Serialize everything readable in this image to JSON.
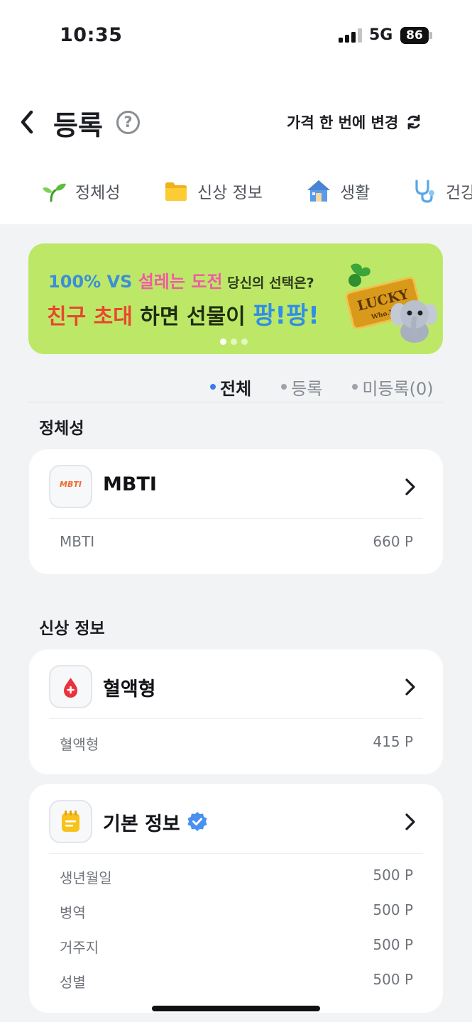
{
  "status_bar": {
    "time": "10:35",
    "network": "5G",
    "battery": "86"
  },
  "header": {
    "title": "등록",
    "help_icon": "question-circle-icon",
    "price_change_label": "가격 한 번에 변경"
  },
  "category_tabs": [
    {
      "label": "정체성",
      "icon": "sprout-icon"
    },
    {
      "label": "신상 정보",
      "icon": "folder-icon"
    },
    {
      "label": "생활",
      "icon": "house-icon"
    },
    {
      "label": "건강",
      "icon": "stethoscope-icon"
    }
  ],
  "banner": {
    "line1_part1": "100% VS ",
    "line1_part2": "설레는 도전",
    "line1_part3": " 당신의 선택은?",
    "line2_part1": "친구 초대",
    "line2_part2": " 하면 선물이 ",
    "line2_part3": "팡!팡!",
    "ticket_text": "LUCKY",
    "ticket_sub": "Who.M.I",
    "pages": 3,
    "current_page": 1
  },
  "filter": {
    "all": "전체",
    "registered": "등록",
    "unregistered": "미등록(0)",
    "active": "all"
  },
  "sections": {
    "identity": {
      "title": "정체성",
      "card": {
        "title": "MBTI",
        "icon_text": "MBTI",
        "rows": [
          {
            "label": "MBTI",
            "value": "660 P"
          }
        ]
      }
    },
    "personal": {
      "title": "신상 정보",
      "blood": {
        "title": "혈액형",
        "rows": [
          {
            "label": "혈액형",
            "value": "415 P"
          }
        ]
      },
      "basic": {
        "title": "기본 정보",
        "verified": true,
        "rows": [
          {
            "label": "생년월일",
            "value": "500 P"
          },
          {
            "label": "병역",
            "value": "500 P"
          },
          {
            "label": "거주지",
            "value": "500 P"
          },
          {
            "label": "성별",
            "value": "500 P"
          }
        ]
      }
    }
  },
  "colors": {
    "accent": "#3a7bf0",
    "banner_bg": "#bde867",
    "background": "#f2f3f5"
  }
}
